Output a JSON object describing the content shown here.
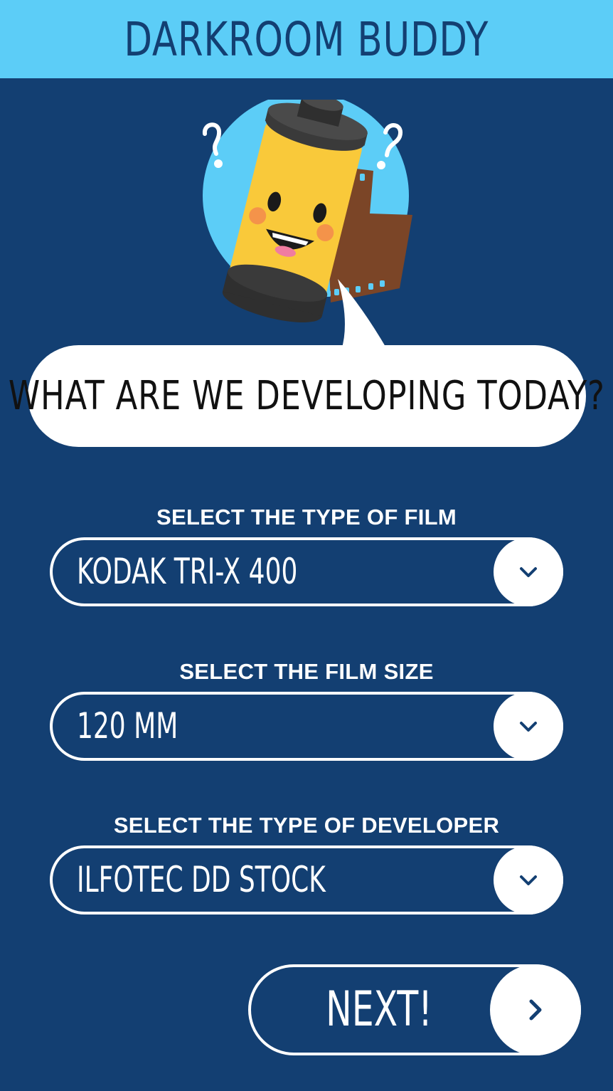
{
  "header": {
    "title": "DARKROOM BUDDY"
  },
  "colors": {
    "background": "#133f72",
    "header": "#5ccdf7",
    "accent_yellow": "#f9c93a",
    "film_brown": "#7b4527"
  },
  "prompt": {
    "text": "WHAT ARE WE DEVELOPING TODAY?"
  },
  "film_type": {
    "label": "SELECT THE TYPE OF FILM",
    "value": "KODAK TRI-X 400",
    "icon": "chevron-down-icon"
  },
  "film_size": {
    "label": "SELECT THE FILM SIZE",
    "value": "120 MM",
    "icon": "chevron-down-icon"
  },
  "developer": {
    "label": "SELECT THE TYPE OF DEVELOPER",
    "value": "ILFOTEC DD STOCK",
    "icon": "chevron-down-icon"
  },
  "next": {
    "label": "NEXT!",
    "icon": "chevron-right-icon"
  }
}
